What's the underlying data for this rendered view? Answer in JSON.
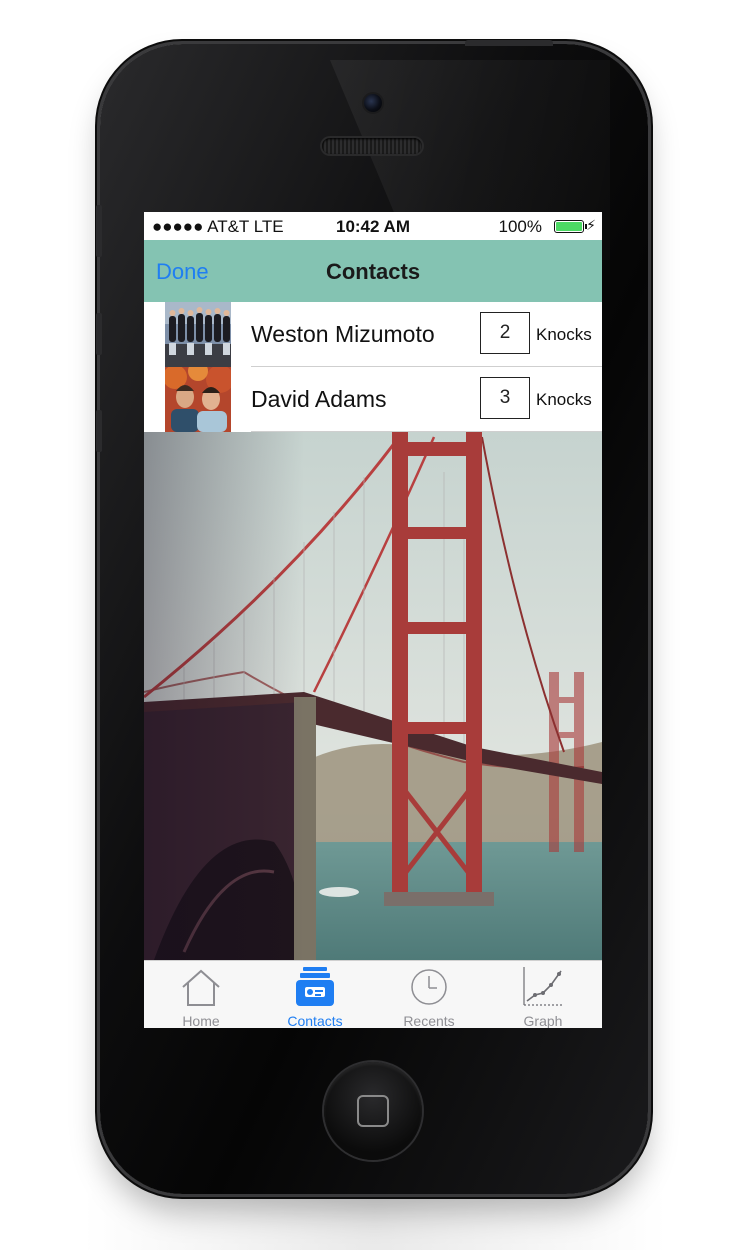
{
  "status_bar": {
    "carrier": "●●●●● AT&T  LTE",
    "time": "10:42 AM",
    "battery_pct": "100%",
    "battery_level": 1.0,
    "battery_color": "#4cd964"
  },
  "nav": {
    "done_label": "Done",
    "title": "Contacts",
    "bar_color": "#84c3b2"
  },
  "contacts": [
    {
      "name": "Weston Mizumoto",
      "count": "2",
      "unit": "Knocks"
    },
    {
      "name": "David Adams",
      "count": "3",
      "unit": "Knocks"
    }
  ],
  "tabs": [
    {
      "label": "Home",
      "icon": "house-icon",
      "active": false
    },
    {
      "label": "Contacts",
      "icon": "contacts-icon",
      "active": true
    },
    {
      "label": "Recents",
      "icon": "clock-icon",
      "active": false
    },
    {
      "label": "Graph",
      "icon": "graph-icon",
      "active": false
    }
  ],
  "accent_color": "#1f7ef2"
}
